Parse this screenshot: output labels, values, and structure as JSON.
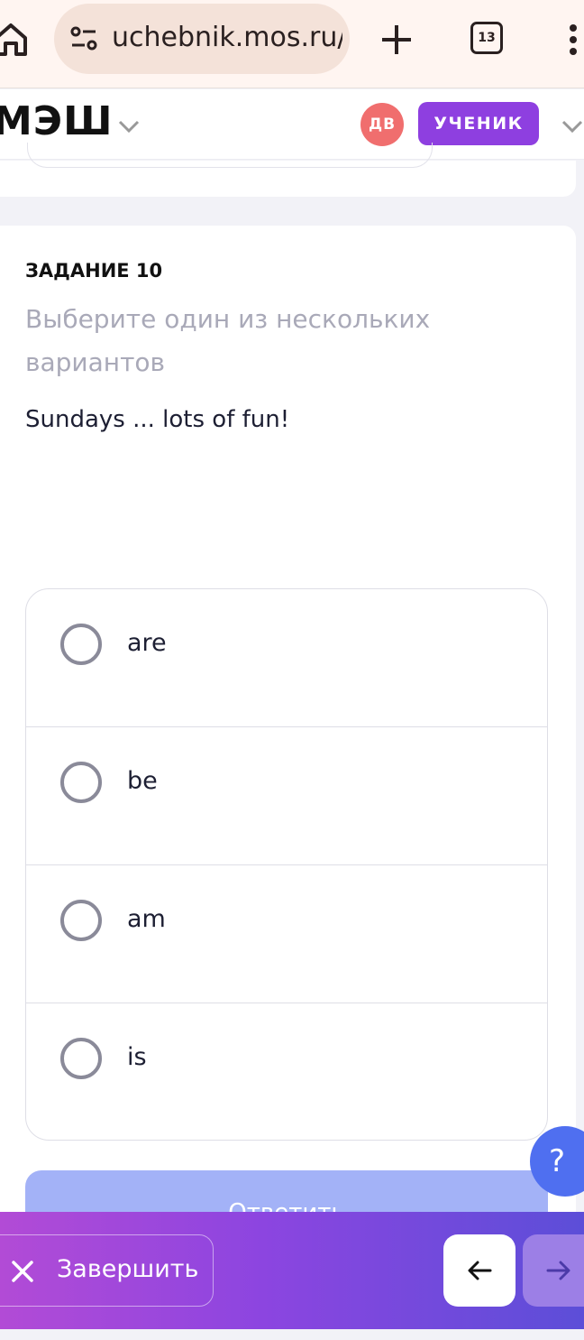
{
  "browser": {
    "url": "uchebnik.mos.ru/",
    "tab_count": "13",
    "icons": [
      "home-icon",
      "tune-icon",
      "plus-icon",
      "tabs-icon",
      "more-vert-icon"
    ]
  },
  "header": {
    "logo": "МЭШ",
    "avatar_initials": "ДВ",
    "role": "УЧЕНИК"
  },
  "task": {
    "number": "ЗАДАНИЕ 10",
    "instruction": "Выберите один из нескольких вариантов",
    "question": "Sundays ... lots of fun!",
    "options": [
      {
        "label": "are"
      },
      {
        "label": "be"
      },
      {
        "label": "am"
      },
      {
        "label": "is"
      }
    ],
    "answer_label": "Ответить"
  },
  "help": {
    "label": "?"
  },
  "footer": {
    "finish_label": "Завершить"
  },
  "colors": {
    "accent": "#8e3fe0",
    "avatar": "#f06e6e",
    "answer_disabled": "#a3b2f7",
    "help": "#4f6ff0"
  }
}
